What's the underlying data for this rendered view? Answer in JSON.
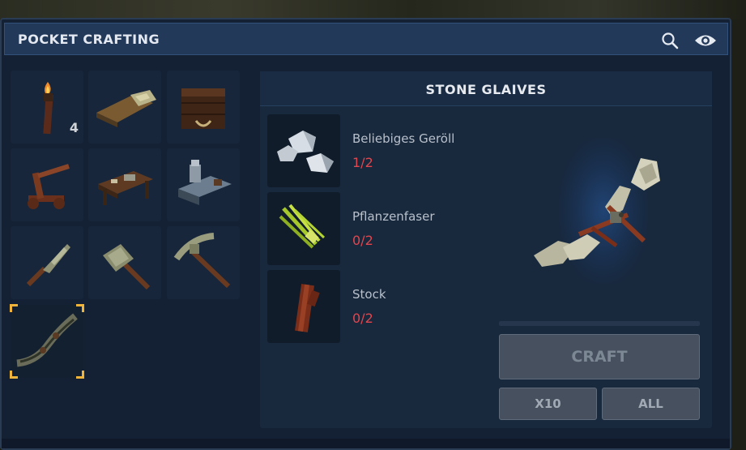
{
  "window": {
    "title": "POCKET CRAFTING"
  },
  "header_icons": [
    "search-icon",
    "eye-icon"
  ],
  "recipe_grid": [
    {
      "name": "torch",
      "count": "4"
    },
    {
      "name": "bedroll",
      "count": ""
    },
    {
      "name": "storage-chest",
      "count": ""
    },
    {
      "name": "wooden-catapult",
      "count": ""
    },
    {
      "name": "workbench",
      "count": ""
    },
    {
      "name": "anvil-station",
      "count": ""
    },
    {
      "name": "stone-knife",
      "count": ""
    },
    {
      "name": "stone-hammer",
      "count": ""
    },
    {
      "name": "stone-pickaxe",
      "count": ""
    },
    {
      "name": "stone-glaives",
      "count": "",
      "selected": true
    }
  ],
  "detail": {
    "title": "STONE GLAIVES",
    "ingredients": [
      {
        "name": "Beliebiges Geröll",
        "count": "1/2",
        "icon": "rock-icon"
      },
      {
        "name": "Pflanzenfaser",
        "count": "0/2",
        "icon": "plant-fiber-icon"
      },
      {
        "name": "Stock",
        "count": "0/2",
        "icon": "stick-icon"
      }
    ],
    "craft_label": "CRAFT",
    "x10_label": "X10",
    "all_label": "ALL"
  },
  "colors": {
    "window_bg": "#142134",
    "titlebar": "#22395a",
    "slot": "#17263a",
    "selected_corner": "#f0b43a",
    "missing_count": "#e0474e",
    "button": "#46505e"
  }
}
